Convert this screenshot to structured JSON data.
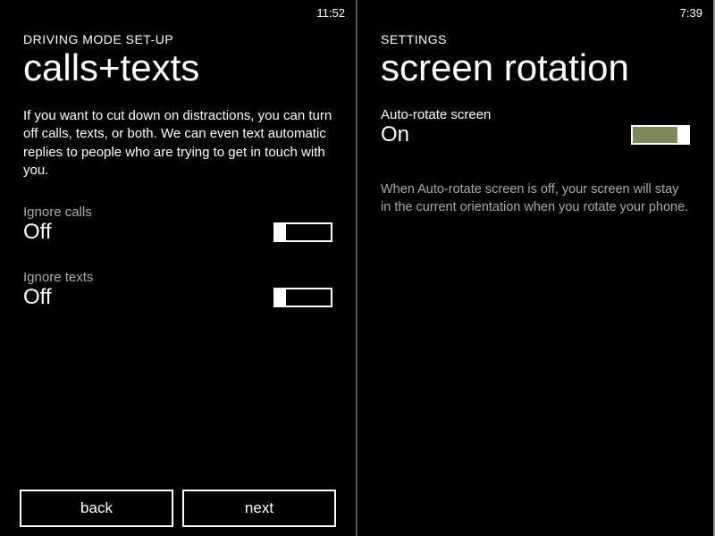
{
  "left": {
    "status": {
      "time": "11:52"
    },
    "breadcrumb": "DRIVING MODE SET-UP",
    "title": "calls+texts",
    "description": "If you want to cut down on distractions, you can turn off calls, texts, or both. We can even text automatic replies to people who are trying to get in touch with you.",
    "settings": {
      "ignore_calls": {
        "label": "Ignore calls",
        "value": "Off",
        "on": false
      },
      "ignore_texts": {
        "label": "Ignore texts",
        "value": "Off",
        "on": false
      }
    },
    "buttons": {
      "back": "back",
      "next": "next"
    }
  },
  "right": {
    "status": {
      "time": "7:39"
    },
    "breadcrumb": "SETTINGS",
    "title": "screen rotation",
    "settings": {
      "auto_rotate": {
        "label": "Auto-rotate screen",
        "value": "On",
        "on": true
      }
    },
    "help": "When Auto-rotate screen is off, your screen will stay in the current orientation when you rotate your phone."
  }
}
